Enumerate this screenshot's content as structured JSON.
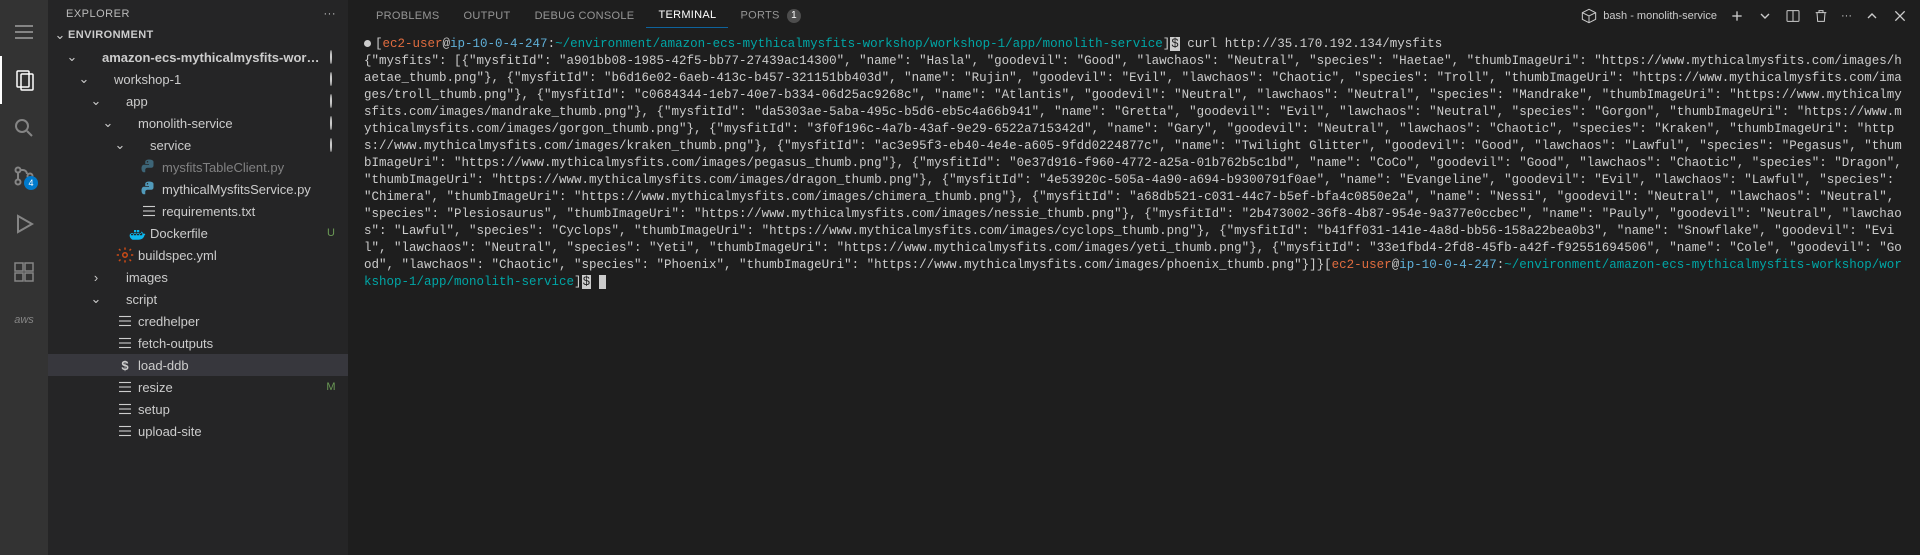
{
  "activity": {
    "scm_badge": "4"
  },
  "sidebar": {
    "title": "EXPLORER",
    "section": "ENVIRONMENT",
    "tree": [
      {
        "indent": 1,
        "chev": "down",
        "label": "amazon-ecs-mythicalmysfits-workshop",
        "kind": "folder",
        "unsaved": true
      },
      {
        "indent": 2,
        "chev": "down",
        "label": "workshop-1",
        "kind": "folder",
        "unsaved": true
      },
      {
        "indent": 3,
        "chev": "down",
        "label": "app",
        "kind": "folder",
        "unsaved": true
      },
      {
        "indent": 4,
        "chev": "down",
        "label": "monolith-service",
        "kind": "folder",
        "unsaved": true
      },
      {
        "indent": 5,
        "chev": "down",
        "label": "service",
        "kind": "folder",
        "unsaved": true
      },
      {
        "indent": 6,
        "chev": "",
        "label": "mysfitsTableClient.py",
        "kind": "py",
        "dim": true
      },
      {
        "indent": 6,
        "chev": "",
        "label": "mythicalMysfitsService.py",
        "kind": "py"
      },
      {
        "indent": 6,
        "chev": "",
        "label": "requirements.txt",
        "kind": "file"
      },
      {
        "indent": 5,
        "chev": "",
        "label": "Dockerfile",
        "kind": "docker",
        "status": "U"
      },
      {
        "indent": 4,
        "chev": "",
        "label": "buildspec.yml",
        "kind": "yml"
      },
      {
        "indent": 3,
        "chev": "right",
        "label": "images",
        "kind": "folder"
      },
      {
        "indent": 3,
        "chev": "down",
        "label": "script",
        "kind": "folder"
      },
      {
        "indent": 4,
        "chev": "",
        "label": "credhelper",
        "kind": "file"
      },
      {
        "indent": 4,
        "chev": "",
        "label": "fetch-outputs",
        "kind": "file"
      },
      {
        "indent": 4,
        "chev": "",
        "label": "load-ddb",
        "kind": "sh",
        "selected": true
      },
      {
        "indent": 4,
        "chev": "",
        "label": "resize",
        "kind": "file",
        "status": "M"
      },
      {
        "indent": 4,
        "chev": "",
        "label": "setup",
        "kind": "file"
      },
      {
        "indent": 4,
        "chev": "",
        "label": "upload-site",
        "kind": "file"
      }
    ]
  },
  "panel": {
    "tabs": {
      "problems": "PROBLEMS",
      "output": "OUTPUT",
      "debug": "DEBUG CONSOLE",
      "terminal": "TERMINAL",
      "ports": "PORTS",
      "ports_count": "1"
    },
    "shell": "bash - monolith-service"
  },
  "terminal": {
    "prompt": {
      "user": "ec2-user",
      "at": "@",
      "host": "ip-10-0-4-247",
      "colon": ":",
      "path": "~/environment/amazon-ecs-mythicalmysfits-workshop/workshop-1/app/monolith-service",
      "dollar": "$"
    },
    "command": " curl http://35.170.192.134/mysfits",
    "output": "{\"mysfits\": [{\"mysfitId\": \"a901bb08-1985-42f5-bb77-27439ac14300\", \"name\": \"Hasla\", \"goodevil\": \"Good\", \"lawchaos\": \"Neutral\", \"species\": \"Haetae\", \"thumbImageUri\": \"https://www.mythicalmysfits.com/images/haetae_thumb.png\"}, {\"mysfitId\": \"b6d16e02-6aeb-413c-b457-321151bb403d\", \"name\": \"Rujin\", \"goodevil\": \"Evil\", \"lawchaos\": \"Chaotic\", \"species\": \"Troll\", \"thumbImageUri\": \"https://www.mythicalmysfits.com/images/troll_thumb.png\"}, {\"mysfitId\": \"c0684344-1eb7-40e7-b334-06d25ac9268c\", \"name\": \"Atlantis\", \"goodevil\": \"Neutral\", \"lawchaos\": \"Neutral\", \"species\": \"Mandrake\", \"thumbImageUri\": \"https://www.mythicalmysfits.com/images/mandrake_thumb.png\"}, {\"mysfitId\": \"da5303ae-5aba-495c-b5d6-eb5c4a66b941\", \"name\": \"Gretta\", \"goodevil\": \"Evil\", \"lawchaos\": \"Neutral\", \"species\": \"Gorgon\", \"thumbImageUri\": \"https://www.mythicalmysfits.com/images/gorgon_thumb.png\"}, {\"mysfitId\": \"3f0f196c-4a7b-43af-9e29-6522a715342d\", \"name\": \"Gary\", \"goodevil\": \"Neutral\", \"lawchaos\": \"Chaotic\", \"species\": \"Kraken\", \"thumbImageUri\": \"https://www.mythicalmysfits.com/images/kraken_thumb.png\"}, {\"mysfitId\": \"ac3e95f3-eb40-4e4e-a605-9fdd0224877c\", \"name\": \"Twilight Glitter\", \"goodevil\": \"Good\", \"lawchaos\": \"Lawful\", \"species\": \"Pegasus\", \"thumbImageUri\": \"https://www.mythicalmysfits.com/images/pegasus_thumb.png\"}, {\"mysfitId\": \"0e37d916-f960-4772-a25a-01b762b5c1bd\", \"name\": \"CoCo\", \"goodevil\": \"Good\", \"lawchaos\": \"Chaotic\", \"species\": \"Dragon\", \"thumbImageUri\": \"https://www.mythicalmysfits.com/images/dragon_thumb.png\"}, {\"mysfitId\": \"4e53920c-505a-4a90-a694-b9300791f0ae\", \"name\": \"Evangeline\", \"goodevil\": \"Evil\", \"lawchaos\": \"Lawful\", \"species\": \"Chimera\", \"thumbImageUri\": \"https://www.mythicalmysfits.com/images/chimera_thumb.png\"}, {\"mysfitId\": \"a68db521-c031-44c7-b5ef-bfa4c0850e2a\", \"name\": \"Nessi\", \"goodevil\": \"Neutral\", \"lawchaos\": \"Neutral\", \"species\": \"Plesiosaurus\", \"thumbImageUri\": \"https://www.mythicalmysfits.com/images/nessie_thumb.png\"}, {\"mysfitId\": \"2b473002-36f8-4b87-954e-9a377e0ccbec\", \"name\": \"Pauly\", \"goodevil\": \"Neutral\", \"lawchaos\": \"Lawful\", \"species\": \"Cyclops\", \"thumbImageUri\": \"https://www.mythicalmysfits.com/images/cyclops_thumb.png\"}, {\"mysfitId\": \"b41ff031-141e-4a8d-bb56-158a22bea0b3\", \"name\": \"Snowflake\", \"goodevil\": \"Evil\", \"lawchaos\": \"Neutral\", \"species\": \"Yeti\", \"thumbImageUri\": \"https://www.mythicalmysfits.com/images/yeti_thumb.png\"}, {\"mysfitId\": \"33e1fbd4-2fd8-45fb-a42f-f92551694506\", \"name\": \"Cole\", \"goodevil\": \"Good\", \"lawchaos\": \"Chaotic\", \"species\": \"Phoenix\", \"thumbImageUri\": \"https://www.mythicalmysfits.com/images/phoenix_thumb.png\"}]}"
  }
}
